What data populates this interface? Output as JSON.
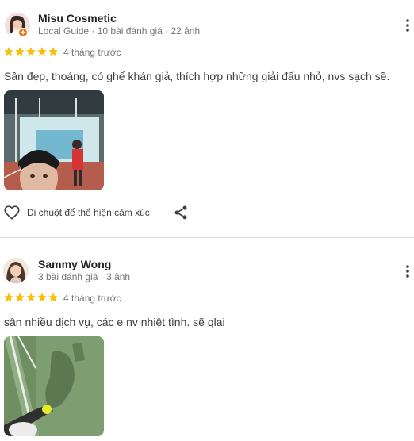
{
  "reviews": [
    {
      "name": "Misu Cosmetic",
      "meta": "Local Guide · 10 bài đánh giá · 22 ảnh",
      "rating": 5,
      "time": "4 tháng trước",
      "text": "Sân đẹp, thoáng, có ghế khán giả, thích hợp những giải đấu nhỏ, nvs sạch sẽ.",
      "react_label": "Di chuột để thể hiện cảm xúc",
      "icons": {
        "more": "more-vert-icon",
        "heart": "heart-outline-icon",
        "share": "share-icon",
        "badge": "local-guide-badge-icon"
      }
    },
    {
      "name": "Sammy Wong",
      "meta": "3 bài đánh giá · 3 ảnh",
      "rating": 5,
      "time": "4 tháng trước",
      "text": "sân nhiều dịch vụ, các e nv nhiệt tình. sẽ qlai",
      "icons": {
        "more": "more-vert-icon"
      }
    }
  ],
  "colors": {
    "star": "#fbbc04",
    "badge": "#e8710a",
    "divider": "#dadce0",
    "muted_text": "#70757a"
  }
}
